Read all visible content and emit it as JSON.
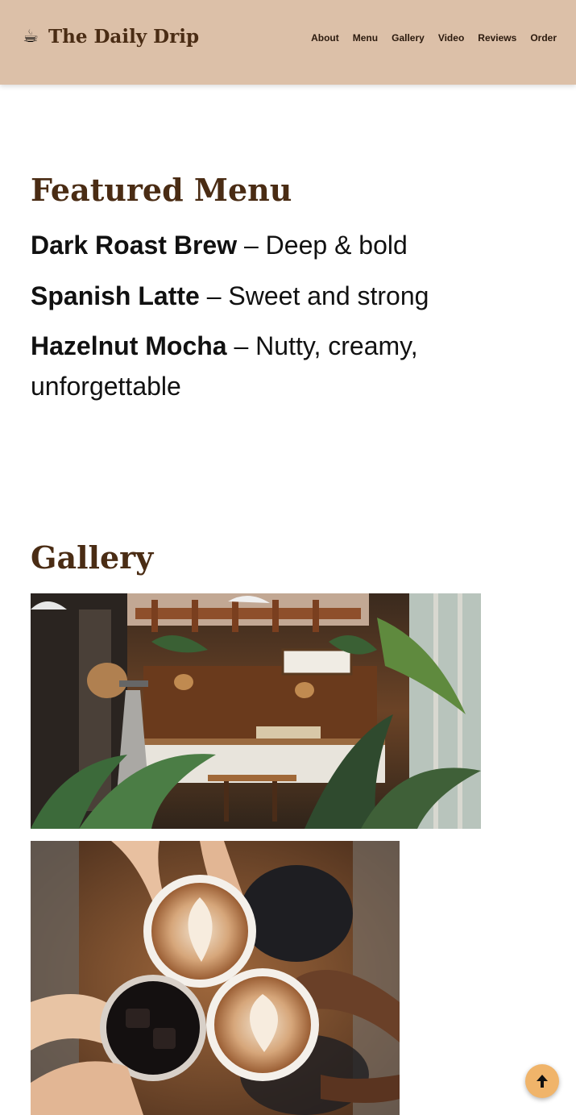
{
  "header": {
    "brand_icon": "coffee-cup-icon",
    "brand_glyph": "☕",
    "brand_name": "The Daily Drip",
    "nav": [
      {
        "label": "About"
      },
      {
        "label": "Menu"
      },
      {
        "label": "Gallery"
      },
      {
        "label": "Video"
      },
      {
        "label": "Reviews"
      },
      {
        "label": "Order"
      }
    ]
  },
  "menu": {
    "title": "Featured Menu",
    "items": [
      {
        "name": "Dark Roast Brew",
        "desc": " – Deep & bold"
      },
      {
        "name": "Spanish Latte",
        "desc": " – Sweet and strong"
      },
      {
        "name": "Hazelnut Mocha",
        "desc": " – Nutty, creamy, unforgettable"
      }
    ]
  },
  "gallery": {
    "title": "Gallery"
  },
  "scroll_top": {
    "icon": "arrow-up-icon"
  },
  "colors": {
    "header_bg": "#dcc0a8",
    "heading": "#4a2c14",
    "accent": "#f0b46a"
  }
}
